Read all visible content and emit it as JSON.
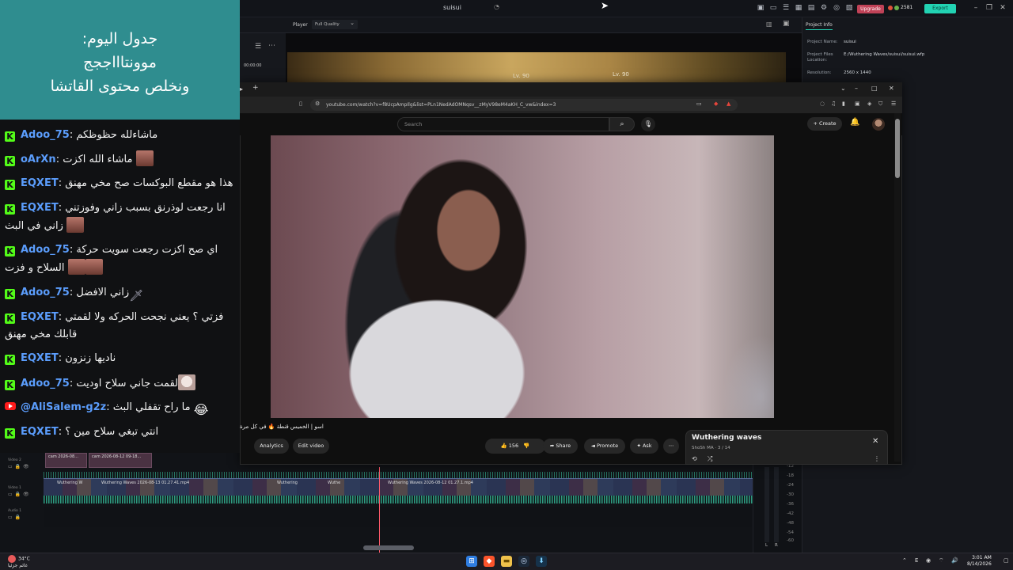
{
  "editor": {
    "title": "suisui",
    "upgrade": "Upgrade",
    "credits": "2581",
    "export": "Export",
    "player_label": "Player",
    "quality": "Full Quality",
    "timecode": "00:00:00",
    "preview_level_1": "Lv. 90",
    "preview_level_2": "Lv. 90",
    "project_tab": "Project Info",
    "project_name_label": "Project Name:",
    "project_name": "suisui",
    "project_files_label": "Project Files Location:",
    "project_files": "E:/Wuthering Waves/suisui/suisui.wfp",
    "resolution_label": "Resolution:",
    "resolution": "2560 x 1440",
    "tracks": [
      {
        "label": "Video 2"
      },
      {
        "label": "Video 1"
      },
      {
        "label": "Audio 1"
      }
    ],
    "clips_v2": [
      "cam 2026-08...",
      "cam 2026-08-12 09-18..."
    ],
    "clips_v1": [
      "Wuthering W",
      "Wuthering Waves 2026-08-13 01.27.41.mp4",
      "Wuthering",
      "Wuthe",
      "Wuthering Waves 2026-08-12 01.27.1.mp4"
    ],
    "meter_scale": [
      "-12",
      "-18",
      "-24",
      "-30",
      "-36",
      "-42",
      "-48",
      "-54",
      "-60"
    ],
    "meter_l": "L",
    "meter_r": "R"
  },
  "browser": {
    "url": "youtube.com/watch?v=f8UcpAmpIlg&list=PLn1NedAdOMNqsv__zMyV98eM4aKH_C_vw&index=3",
    "search_placeholder": "Search",
    "create": "Create",
    "video_title": "اسو | الخميس قنطة 🔥 في كل مرة",
    "analytics": "Analytics",
    "edit_video": "Edit video",
    "likes": "156",
    "share": "Share",
    "promote": "Promote",
    "ask": "Ask",
    "playlist_title": "Wuthering waves",
    "playlist_sub": "ShoSh MA · 3 / 14"
  },
  "schedule": {
    "line1": "جدول اليوم:",
    "line2": "موونتاااججج",
    "line3": "ونخلص محتوى القاتشا"
  },
  "chat": [
    {
      "platform": "kick",
      "user": "Adoo_75",
      "text": "ماشاءلله حظوظكم",
      "emote": ""
    },
    {
      "platform": "kick",
      "user": "oArXn",
      "text": "ماشاء الله اكزت",
      "emote": "face"
    },
    {
      "platform": "kick",
      "user": "EQXET",
      "text": "هذا هو مقطع البوكسات صح مخي مهنق",
      "emote": ""
    },
    {
      "platform": "kick",
      "user": "EQXET",
      "text": "انا رجعت لوذرنق بسبب زاني وفوزتني زاني في البث",
      "emote": "face"
    },
    {
      "platform": "kick",
      "user": "Adoo_75",
      "text": "اي صح اكزت رجعت سويت حركة السلاح و فزت",
      "emote": "face2"
    },
    {
      "platform": "kick",
      "user": "Adoo_75",
      "text": "زاني الافضل",
      "emote": "sword"
    },
    {
      "platform": "kick",
      "user": "EQXET",
      "text": "فزتي ؟ يعني نجحت الحركه ولا لقمتي قابلك مخي مهنق",
      "emote": ""
    },
    {
      "platform": "kick",
      "user": "EQXET",
      "text": "ناديها زنزون",
      "emote": ""
    },
    {
      "platform": "kick",
      "user": "Adoo_75",
      "text": "لقمت جاني سلاح اوديت",
      "emote": "cat"
    },
    {
      "platform": "youtube",
      "user": "@AliSalem-g2z",
      "text": "ما راح تقفلي البث",
      "emote": "laugh"
    },
    {
      "platform": "kick",
      "user": "EQXET",
      "text": "انتي تبغي سلاح مين ؟",
      "emote": ""
    }
  ],
  "taskbar": {
    "temp": "34°C",
    "weather_text": "غائم جزئيا",
    "time": "3:01 AM",
    "date": "8/14/2026",
    "lang": "E"
  },
  "colors": {
    "schedule_bg": "#2f8d8f",
    "chat_bg": "#101113",
    "kick_green": "#53fc18",
    "username_blue": "#5b9dfc",
    "export_teal": "#22d3b3",
    "upgrade_red": "#c04257"
  }
}
